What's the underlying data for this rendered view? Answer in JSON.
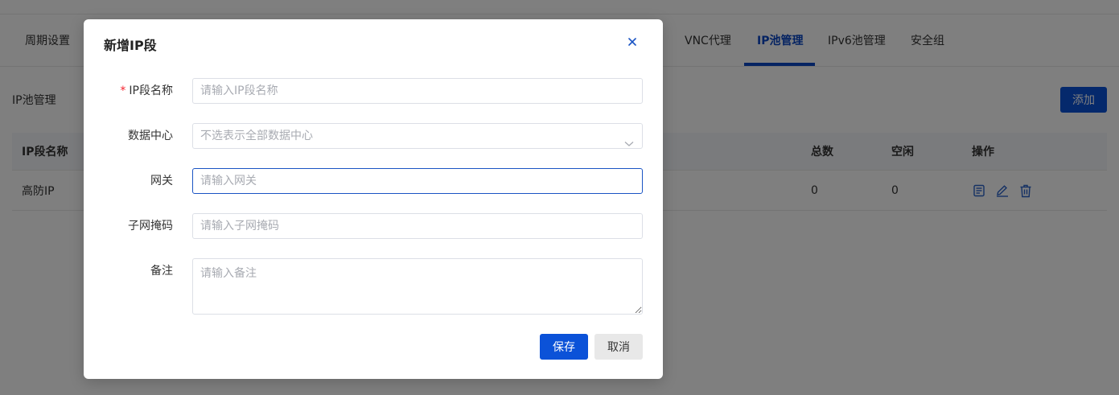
{
  "tabs": [
    {
      "label": "周期设置",
      "active": false
    },
    {
      "label": "VNC代理",
      "active": false
    },
    {
      "label": "IP池管理",
      "active": true
    },
    {
      "label": "IPv6池管理",
      "active": false
    },
    {
      "label": "安全组",
      "active": false
    }
  ],
  "section": {
    "title": "IP池管理",
    "add_label": "添加"
  },
  "table": {
    "headers": [
      "IP段名称",
      "总数",
      "空闲",
      "操作"
    ],
    "rows": [
      {
        "name": "高防IP",
        "total": "0",
        "free": "0"
      }
    ]
  },
  "dialog": {
    "title": "新增IP段",
    "fields": {
      "name": {
        "label": "IP段名称",
        "required_mark": "*",
        "placeholder": "请输入IP段名称",
        "value": ""
      },
      "datacenter": {
        "label": "数据中心",
        "placeholder": "不选表示全部数据中心"
      },
      "gateway": {
        "label": "网关",
        "placeholder": "请输入网关",
        "value": ""
      },
      "netmask": {
        "label": "子网掩码",
        "placeholder": "请输入子网掩码",
        "value": ""
      },
      "remark": {
        "label": "备注",
        "placeholder": "请输入备注",
        "value": ""
      }
    },
    "save_label": "保存",
    "cancel_label": "取消"
  },
  "colors": {
    "primary": "#0b52d8",
    "active_tab": "#0b47c5",
    "icon": "#2a63c9",
    "required": "#f5222d"
  },
  "icons": [
    "close-icon",
    "chevron-down-icon",
    "detail-icon",
    "edit-icon",
    "delete-icon"
  ]
}
